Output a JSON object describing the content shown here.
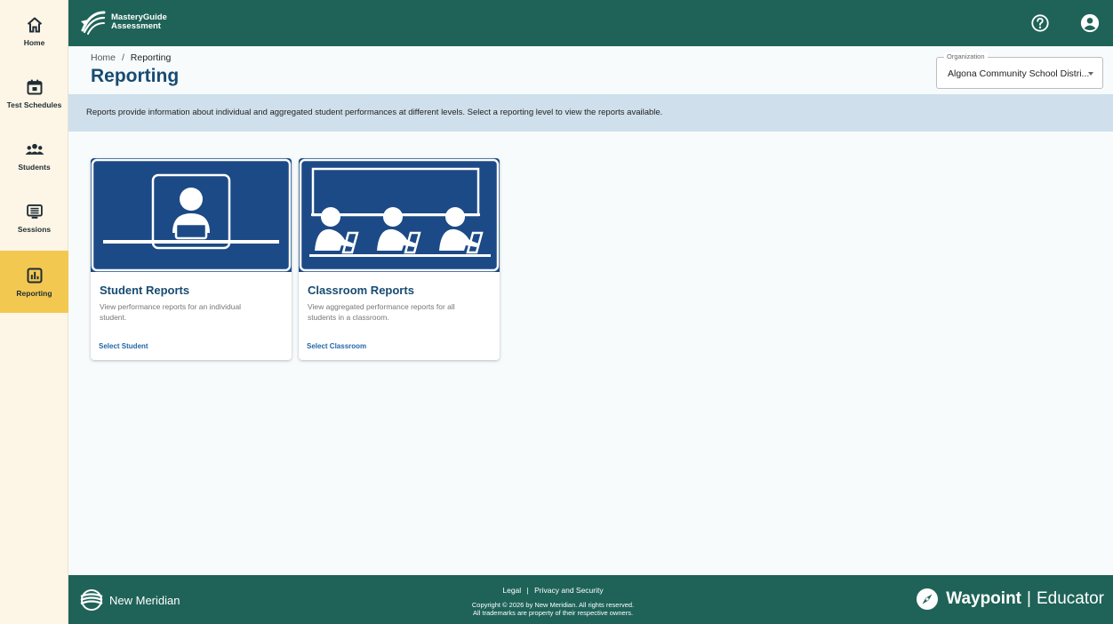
{
  "sidebar": {
    "items": [
      {
        "label": "Home",
        "icon": "home-icon",
        "active": false
      },
      {
        "label": "Test Schedules",
        "icon": "calendar-icon",
        "active": false
      },
      {
        "label": "Students",
        "icon": "students-icon",
        "active": false
      },
      {
        "label": "Sessions",
        "icon": "sessions-icon",
        "active": false
      },
      {
        "label": "Reporting",
        "icon": "reporting-icon",
        "active": true
      }
    ]
  },
  "header": {
    "logo_line1": "MasteryGuide",
    "logo_line2": "Assessment",
    "help_icon": "help-icon",
    "account_icon": "account-icon"
  },
  "breadcrumb": {
    "home": "Home",
    "separator": "/",
    "current": "Reporting"
  },
  "page_title": "Reporting",
  "organization": {
    "label": "Organization",
    "value": "Algona Community School Distri..."
  },
  "banner": "Reports provide information about individual and aggregated student performances at different levels. Select a reporting level to view the reports available.",
  "cards": [
    {
      "title": "Student Reports",
      "description": "View performance reports for an individual student.",
      "link": "Select Student",
      "image": "student-illustration"
    },
    {
      "title": "Classroom Reports",
      "description": "View aggregated performance reports for all students in a classroom.",
      "link": "Select Classroom",
      "image": "classroom-illustration"
    }
  ],
  "footer": {
    "logo": "New Meridian",
    "legal": "Legal",
    "separator": "|",
    "privacy": "Privacy and Security",
    "copyright": "Copyright © 2026 by New Meridian. All rights reserved.",
    "trademarks": "All trademarks are property of their respective owners.",
    "waypoint_brand": "Waypoint",
    "waypoint_sep": "|",
    "waypoint_sub": "Educator"
  },
  "colors": {
    "header_bg": "#1f6358",
    "sidebar_bg": "#fdf6e6",
    "active_nav": "#f3c851",
    "title_blue": "#174b72",
    "card_media": "#1c4a86",
    "banner_bg": "#cfe0ec",
    "link": "#2266a8"
  }
}
